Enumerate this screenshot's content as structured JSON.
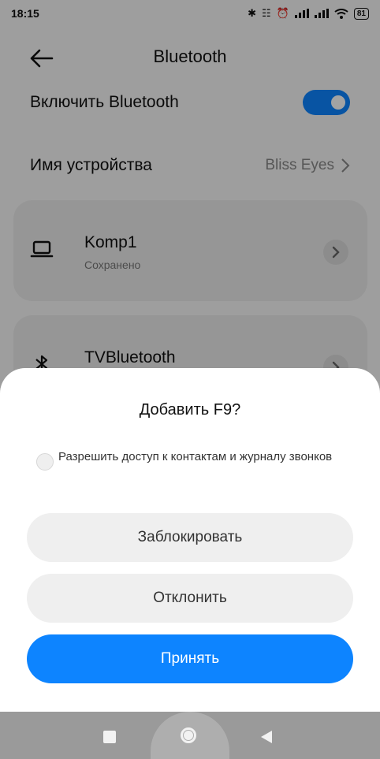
{
  "status_bar": {
    "time": "18:15",
    "battery": "81"
  },
  "header": {
    "title": "Bluetooth"
  },
  "settings": {
    "enable_label": "Включить Bluetooth",
    "enable_on": true,
    "device_name_label": "Имя устройства",
    "device_name_value": "Bliss Eyes"
  },
  "devices": [
    {
      "name": "Komp1",
      "status": "Сохранено",
      "icon": "laptop-icon"
    },
    {
      "name": "TVBluetooth",
      "status": "",
      "icon": "bluetooth-icon"
    }
  ],
  "dialog": {
    "title": "Добавить F9?",
    "checkbox_label": "Разрешить доступ к контактам и журналу звонков",
    "checkbox_checked": false,
    "block_label": "Заблокировать",
    "reject_label": "Отклонить",
    "accept_label": "Принять"
  },
  "colors": {
    "accent": "#0d84ff",
    "scrim": "rgba(0,0,0,0.36)"
  }
}
